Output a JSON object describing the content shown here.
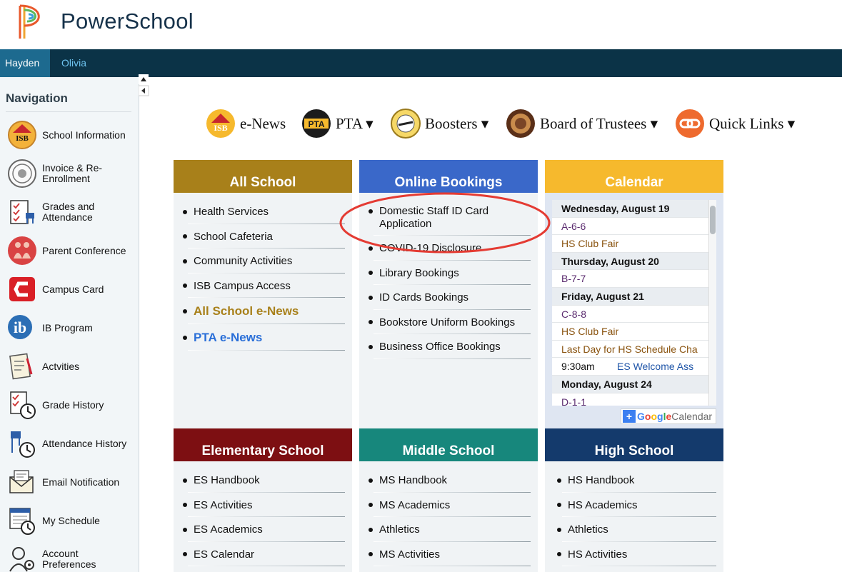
{
  "header": {
    "brand": "PowerSchool"
  },
  "students": [
    {
      "name": "Hayden",
      "active": true
    },
    {
      "name": "Olivia",
      "active": false
    }
  ],
  "sidebar": {
    "title": "Navigation",
    "items": [
      {
        "label": "School Information",
        "icon": "isb-info-icon"
      },
      {
        "label": "Invoice & Re-Enrollment",
        "icon": "seal-icon"
      },
      {
        "label": "Grades and Attendance",
        "icon": "grades-icon"
      },
      {
        "label": "Parent Conference",
        "icon": "parents-icon"
      },
      {
        "label": "Campus Card",
        "icon": "campus-card-icon"
      },
      {
        "label": "IB Program",
        "icon": "ib-icon"
      },
      {
        "label": "Actvities",
        "icon": "activities-icon"
      },
      {
        "label": "Grade History",
        "icon": "grade-history-icon"
      },
      {
        "label": "Attendance History",
        "icon": "attendance-history-icon"
      },
      {
        "label": "Email Notification",
        "icon": "email-icon"
      },
      {
        "label": "My Schedule",
        "icon": "schedule-icon"
      },
      {
        "label": "Account Preferences",
        "icon": "account-icon"
      }
    ]
  },
  "topmenu": [
    {
      "label": "e-News",
      "icon": "isb-enews-icon"
    },
    {
      "label": "PTA ▾",
      "icon": "pta-icon"
    },
    {
      "label": "Boosters ▾",
      "icon": "boosters-icon"
    },
    {
      "label": "Board of Trustees ▾",
      "icon": "trustees-icon"
    },
    {
      "label": "Quick Links ▾",
      "icon": "quick-links-icon"
    }
  ],
  "panels": {
    "all_school": {
      "title": "All School",
      "color": "#a8801a",
      "items": [
        "Health Services",
        "School Cafeteria",
        "Community Activities",
        "ISB Campus Access"
      ],
      "links": [
        "All School e-News",
        "PTA e-News"
      ]
    },
    "online_bookings": {
      "title": "Online Bookings",
      "color": "#3a68c9",
      "items": [
        "Domestic Staff ID Card Application",
        "COVID-19 Disclosure",
        "Library Bookings",
        "ID Cards Bookings",
        "Bookstore Uniform Bookings",
        "Business Office Bookings"
      ]
    },
    "calendar": {
      "title": "Calendar",
      "color": "#f6b92d",
      "rows": [
        {
          "type": "day",
          "text": "Wednesday, August 19"
        },
        {
          "type": "event",
          "text": "A-6-6",
          "style": "purple"
        },
        {
          "type": "event",
          "text": "HS Club Fair",
          "style": "brown"
        },
        {
          "type": "day",
          "text": "Thursday, August 20"
        },
        {
          "type": "event",
          "text": "B-7-7",
          "style": "purple"
        },
        {
          "type": "day",
          "text": "Friday, August 21"
        },
        {
          "type": "event",
          "text": "C-8-8",
          "style": "purple"
        },
        {
          "type": "event",
          "text": "HS Club Fair",
          "style": "brown"
        },
        {
          "type": "event",
          "text": "Last Day for HS Schedule Cha",
          "style": "brown"
        },
        {
          "type": "timed",
          "time": "9:30am",
          "text": "ES Welcome Ass"
        },
        {
          "type": "day",
          "text": "Monday, August 24"
        },
        {
          "type": "event",
          "text": "D-1-1",
          "style": "purple"
        }
      ],
      "google_word": "Google",
      "calendar_word": "Calendar"
    },
    "elementary": {
      "title": "Elementary School",
      "color": "#7d0f12",
      "items": [
        "ES Handbook",
        "ES Activities",
        "ES Academics",
        "ES Calendar"
      ]
    },
    "middle": {
      "title": "Middle School",
      "color": "#17877c",
      "items": [
        "MS Handbook",
        "MS Academics",
        "Athletics",
        "MS Activities"
      ]
    },
    "high": {
      "title": "High School",
      "color": "#143a6c",
      "items": [
        "HS Handbook",
        "HS Academics",
        "Athletics",
        "HS Activities"
      ]
    }
  }
}
